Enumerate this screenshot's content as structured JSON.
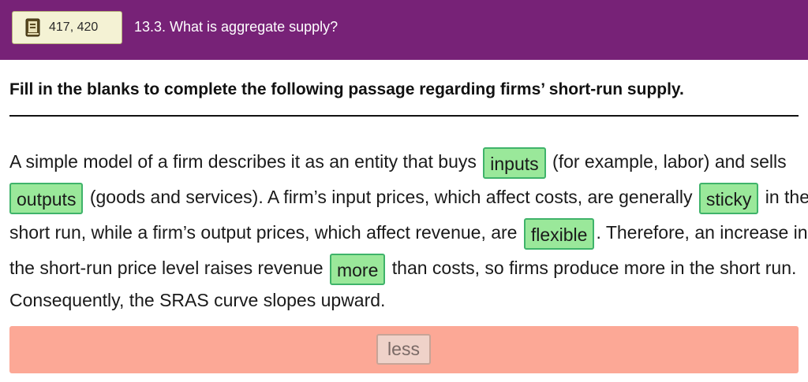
{
  "header": {
    "page_ref": "417, 420",
    "section_title": "13.3. What is aggregate supply?",
    "icon": "book-icon",
    "bg_color": "#772277"
  },
  "instruction": "Fill in the blanks to complete the following passage regarding firms’ short-run supply.",
  "passage": {
    "s1": "A simple model of a firm describes it as an entity that buys",
    "b1": "inputs",
    "s2": "(for example, labor) and sells",
    "b2": "outputs",
    "s3": "(goods and services). A firm’s input prices, which affect costs, are generally",
    "b3": "sticky",
    "s4": "in the",
    "s5": "short run, while a firm’s output prices, which affect revenue, are",
    "b4": "flexible",
    "s6": ". Therefore, an increase in",
    "s7": "the short-run price level raises revenue",
    "b5": "more",
    "s8": "than costs, so firms produce more in the short run.",
    "s9": "Consequently, the SRAS curve slopes upward."
  },
  "answer_bank": {
    "options": [
      "less"
    ],
    "bg_color": "#fca896"
  },
  "colors": {
    "blank_fill": "#9ae89a",
    "blank_border": "#3fb36a"
  }
}
